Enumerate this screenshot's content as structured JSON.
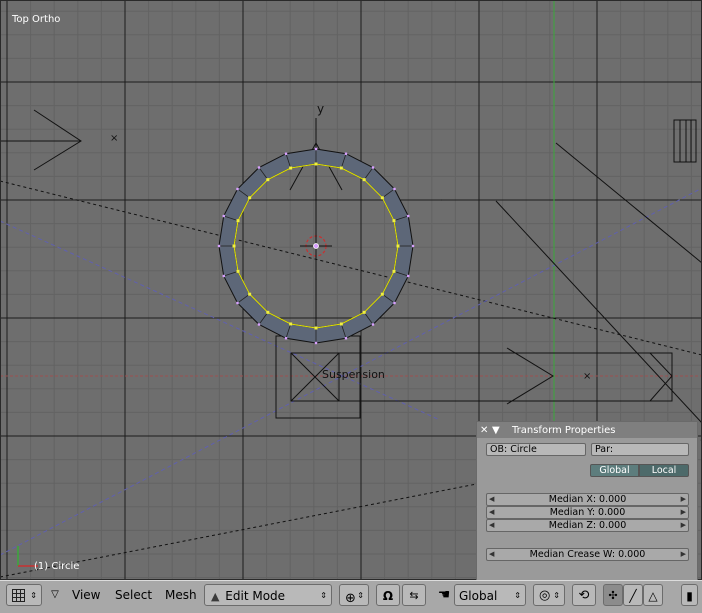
{
  "viewport": {
    "view_name": "Top Ortho",
    "object_label": "(1) Circle",
    "axis_y_label": "y",
    "object_name_label": "Suspension",
    "colors": {
      "background": "#6e6e6e",
      "grid_minor": "#5e5e5e",
      "grid_major": "#1a1a1a",
      "x_axis": "#a04848",
      "y_axis": "#3fa83f",
      "mesh_fill": "#5d6778",
      "edge_selected": "#e6e600",
      "vertex": "#d8a0ff"
    }
  },
  "transform_panel": {
    "title": "Transform Properties",
    "close_icon": "close-icon",
    "collapse_icon": "triangle-down-icon",
    "ob_field": "OB: Circle",
    "par_field": "Par:",
    "toggle_global": "Global",
    "toggle_local": "Local",
    "median_x": "Median X: 0.000",
    "median_y": "Median Y: 0.000",
    "median_z": "Median Z: 0.000",
    "median_crease": "Median Crease W: 0.000"
  },
  "header": {
    "menu_view": "View",
    "menu_select": "Select",
    "menu_mesh": "Mesh",
    "mode": "Edit Mode",
    "orientation": "Global"
  }
}
